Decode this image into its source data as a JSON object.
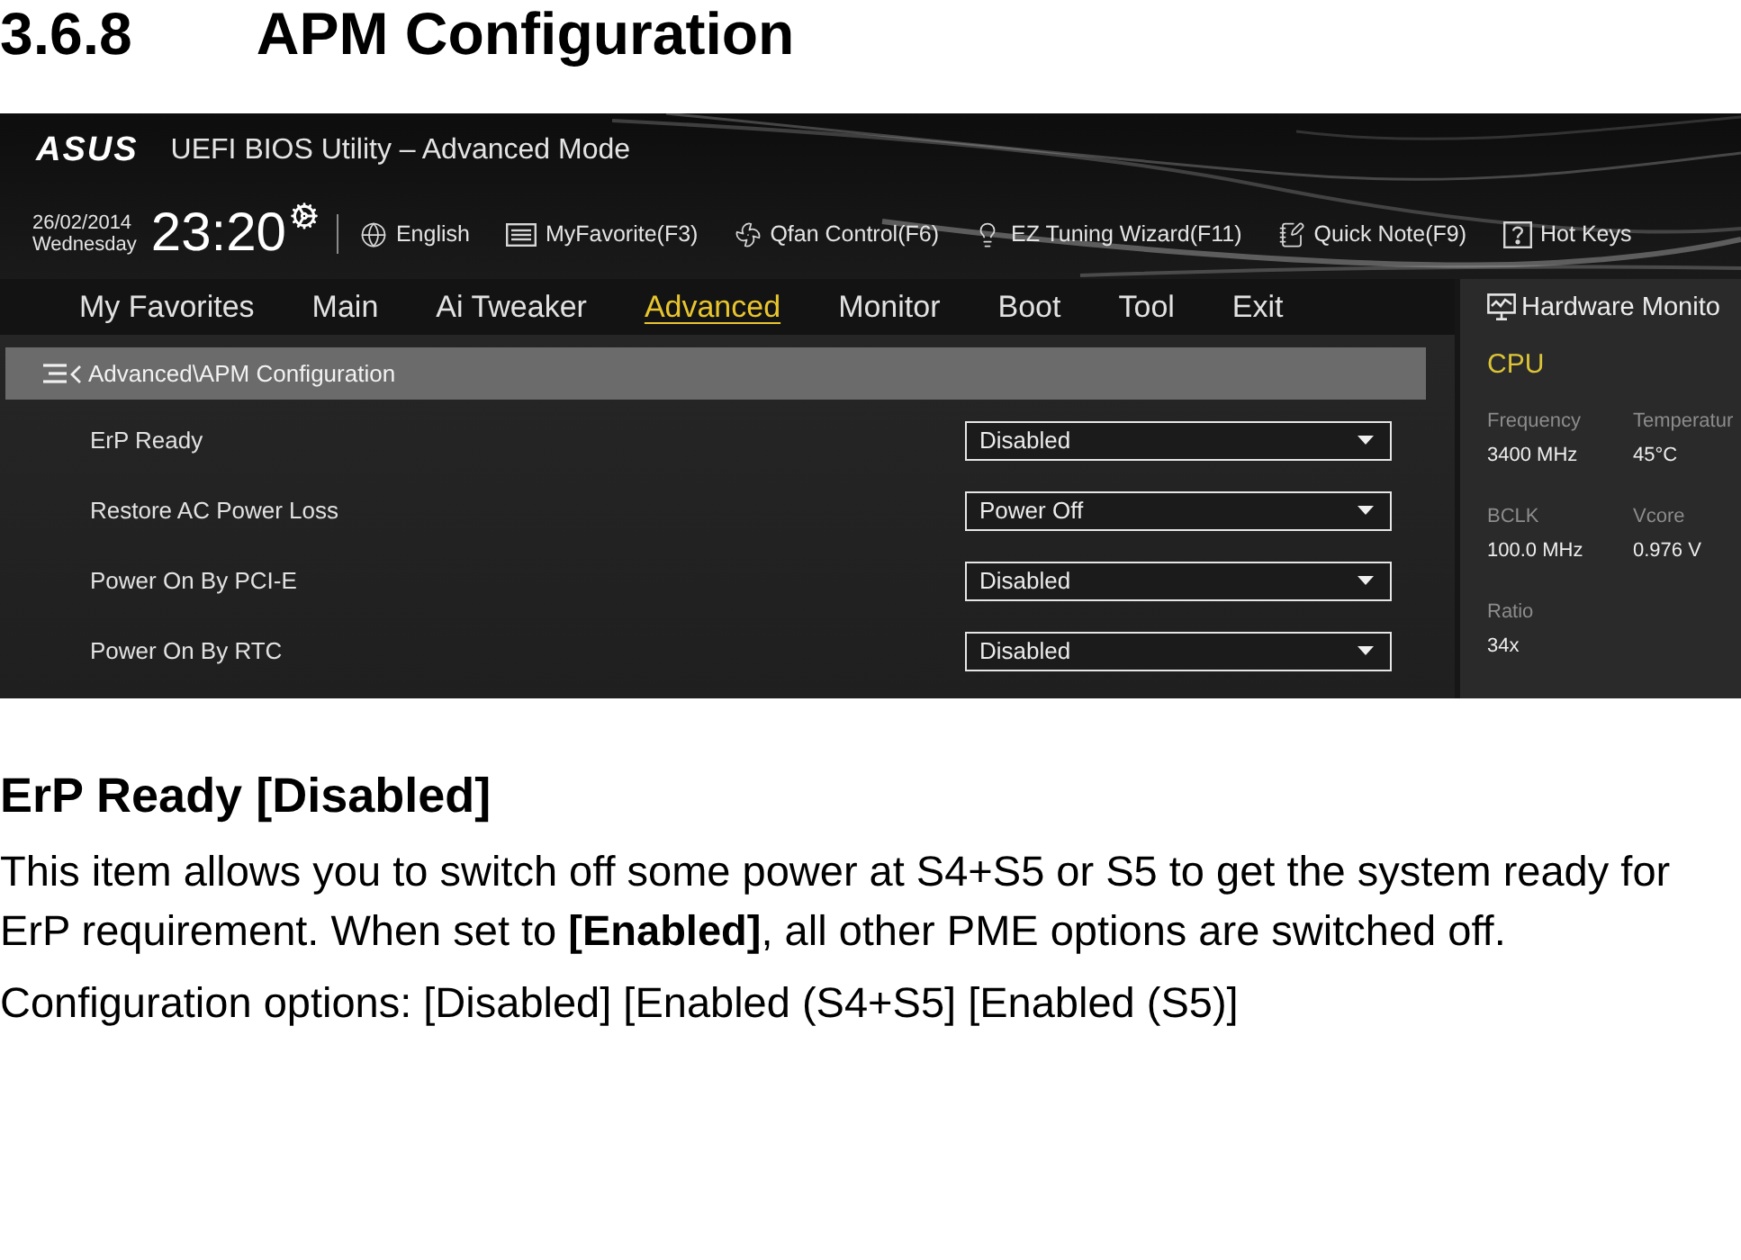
{
  "heading": {
    "number": "3.6.8",
    "title": "APM Configuration"
  },
  "bios": {
    "logo": "ASUS",
    "title": "UEFI BIOS Utility – Advanced Mode",
    "toolbar": {
      "date": "26/02/2014",
      "weekday": "Wednesday",
      "time": "23:20",
      "items": [
        {
          "kind": "language",
          "label": "English"
        },
        {
          "kind": "favorite",
          "label": "MyFavorite(F3)"
        },
        {
          "kind": "fan",
          "label": "Qfan Control(F6)"
        },
        {
          "kind": "wizard",
          "label": "EZ Tuning Wizard(F11)"
        },
        {
          "kind": "note",
          "label": "Quick Note(F9)"
        },
        {
          "kind": "hotkeys",
          "label": "Hot Keys"
        }
      ]
    },
    "tabs": [
      {
        "label": "My Favorites",
        "selected": false
      },
      {
        "label": "Main",
        "selected": false
      },
      {
        "label": "Ai Tweaker",
        "selected": false
      },
      {
        "label": "Advanced",
        "selected": true
      },
      {
        "label": "Monitor",
        "selected": false
      },
      {
        "label": "Boot",
        "selected": false
      },
      {
        "label": "Tool",
        "selected": false
      },
      {
        "label": "Exit",
        "selected": false
      }
    ],
    "breadcrumb": "Advanced\\APM Configuration",
    "settings": [
      {
        "label": "ErP Ready",
        "value": "Disabled"
      },
      {
        "label": "Restore AC Power Loss",
        "value": "Power Off"
      },
      {
        "label": "Power On By PCI-E",
        "value": "Disabled"
      },
      {
        "label": "Power On By RTC",
        "value": "Disabled"
      }
    ],
    "hardware_monitor": {
      "title": "Hardware Monito",
      "section": "CPU",
      "metrics": [
        {
          "label": "Frequency",
          "value": "3400 MHz"
        },
        {
          "label": "Temperatur",
          "value": "45°C"
        },
        {
          "label": "BCLK",
          "value": "100.0 MHz"
        },
        {
          "label": "Vcore",
          "value": "0.976 V"
        },
        {
          "label": "Ratio",
          "value": "34x"
        }
      ]
    }
  },
  "description": {
    "title": "ErP Ready [Disabled]",
    "paragraphs": [
      "This item allows you to switch off some power at S4+S5 or S5 to get the system ready for ErP requirement. When set to **[Enabled]**, all other PME options are switched off.",
      "Configuration options: [Disabled] [Enabled (S4+S5] [Enabled (S5)]"
    ]
  }
}
